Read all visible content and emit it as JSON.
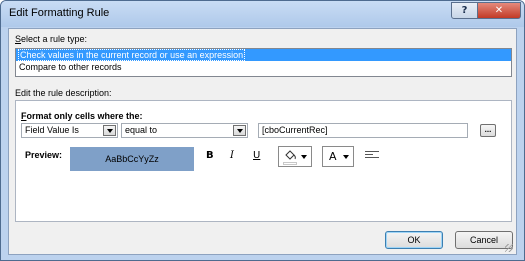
{
  "window": {
    "title": "Edit Formatting Rule",
    "help_glyph": "?",
    "close_glyph": "✕"
  },
  "rule_type": {
    "label_prefix": "",
    "label_underlined": "S",
    "label_rest": "elect a rule type:",
    "options": [
      "Check values in the current record or use an expression",
      "Compare to other records"
    ],
    "selected_index": 0
  },
  "rule_description": {
    "label": "Edit the rule description:",
    "format_label_underlined": "F",
    "format_label_rest": "ormat only cells where the:",
    "condition_type": "Field Value Is",
    "operator": "equal to",
    "value": "[cboCurrentRec]",
    "ellipsis_label": "..."
  },
  "preview": {
    "label": "Preview:",
    "sample_text": "AaBbCcYyZz",
    "background_color": "#7fa0c8"
  },
  "formatting": {
    "bold_label": "B",
    "italic_label": "I",
    "underline_label": "U",
    "fill_icon": "⛟",
    "font_color_label": "A"
  },
  "buttons": {
    "ok": "OK",
    "cancel": "Cancel"
  },
  "colors": {
    "selection": "#3399ff",
    "close": "#c23a26"
  }
}
